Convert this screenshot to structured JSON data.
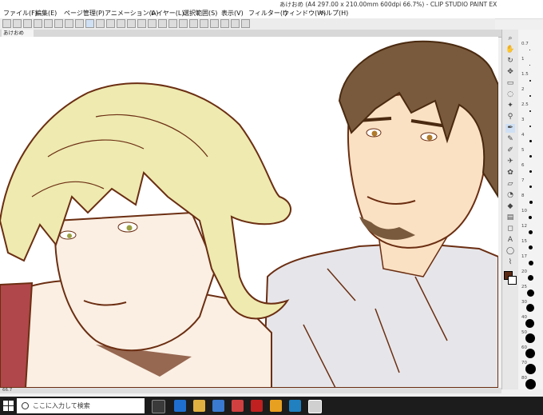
{
  "app": {
    "title": "あけおめ (A4 297.00 x 210.00mm 600dpi 66.7%) - CLIP STUDIO PAINT EX",
    "tab": "あけおめ"
  },
  "menu": [
    "ファイル(F)",
    "編集(E)",
    "ページ管理(P)",
    "アニメーション(A)",
    "レイヤー(L)",
    "選択範囲(S)",
    "表示(V)",
    "フィルター(I)",
    "ウィンドウ(W)",
    "ヘルプ(H)"
  ],
  "brush_sizes": [
    "0.7",
    "1",
    "1.5",
    "2",
    "2.5",
    "3",
    "4",
    "5",
    "6",
    "7",
    "8",
    "10",
    "12",
    "15",
    "17",
    "20",
    "25",
    "30",
    "40",
    "50",
    "60",
    "70",
    "80"
  ],
  "status": {
    "zoom": "66.7"
  },
  "taskbar": {
    "search_placeholder": "ここに入力して検索"
  },
  "colors": {
    "main": "#5a2a14",
    "sub": "#ffffff",
    "hair_blond": "#eeeab0",
    "skin_left": "#fbefe3",
    "skin_right": "#fbe1c3",
    "hair_brown": "#7a5a3c",
    "shirt": "#e6e6ea",
    "lineart": "#6b2e12"
  }
}
